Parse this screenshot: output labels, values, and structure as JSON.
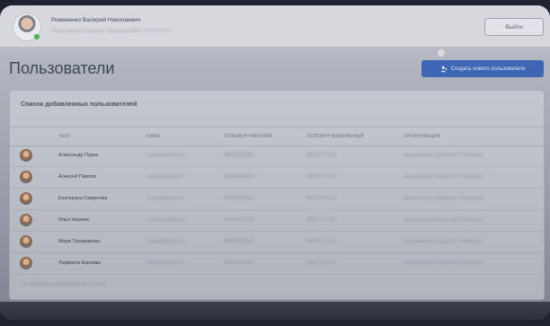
{
  "header": {
    "user_name": "Романенко Валерий Николаевич",
    "user_org": "Акционерное общество Ромашка (ИНН 7777777777)",
    "logout_label": "Выйти"
  },
  "page": {
    "title": "Пользователи",
    "create_button_label": "Создать нового пользователя"
  },
  "panel": {
    "title": "Список добавленных пользователей",
    "columns": [
      "ФИО",
      "EMAIL",
      "ТЕЛЕФОН РАБОЧИЙ",
      "ТЕЛЕФОН МОБИЛЬНЫЙ",
      "ОРГАНИЗАЦИЯ"
    ],
    "rows": [
      {
        "name": "Александр Пурез",
        "email": "example@mail.ru",
        "phone_work": "88005553535",
        "phone_mobile": "89007771122",
        "org": "Акционерное общество \"Ромашка\""
      },
      {
        "name": "Алексей Павлов",
        "email": "example@mail.ru",
        "phone_work": "88005553535",
        "phone_mobile": "89007771122",
        "org": "Акционерное общество \"Ромашка\""
      },
      {
        "name": "Екатерина Смирнова",
        "email": "example@mail.ru",
        "phone_work": "88005553535",
        "phone_mobile": "89007771122",
        "org": "Акционерное общество \"Ромашка\""
      },
      {
        "name": "Илья Наумов",
        "email": "example@mail.ru",
        "phone_work": "88005553535",
        "phone_mobile": "89007771122",
        "org": "Акционерное общество \"Ромашка\""
      },
      {
        "name": "Мари Тихомирова",
        "email": "example@mail.ru",
        "phone_work": "88005553535",
        "phone_mobile": "89007771122",
        "org": "Акционерное общество \"Ромашка\""
      },
      {
        "name": "Людмила Берзова",
        "email": "example@mail.ru",
        "phone_work": "88005553535",
        "phone_mobile": "89007771122",
        "org": "Акционерное общество \"Ромашка\""
      }
    ],
    "footer_text": "Отображено пользователей: 6 из 30"
  },
  "icons": {
    "create_button_icon": "add-user-icon"
  },
  "colors": {
    "accent": "#3f66b4",
    "background": "#1f2230",
    "online": "#4caf50"
  }
}
